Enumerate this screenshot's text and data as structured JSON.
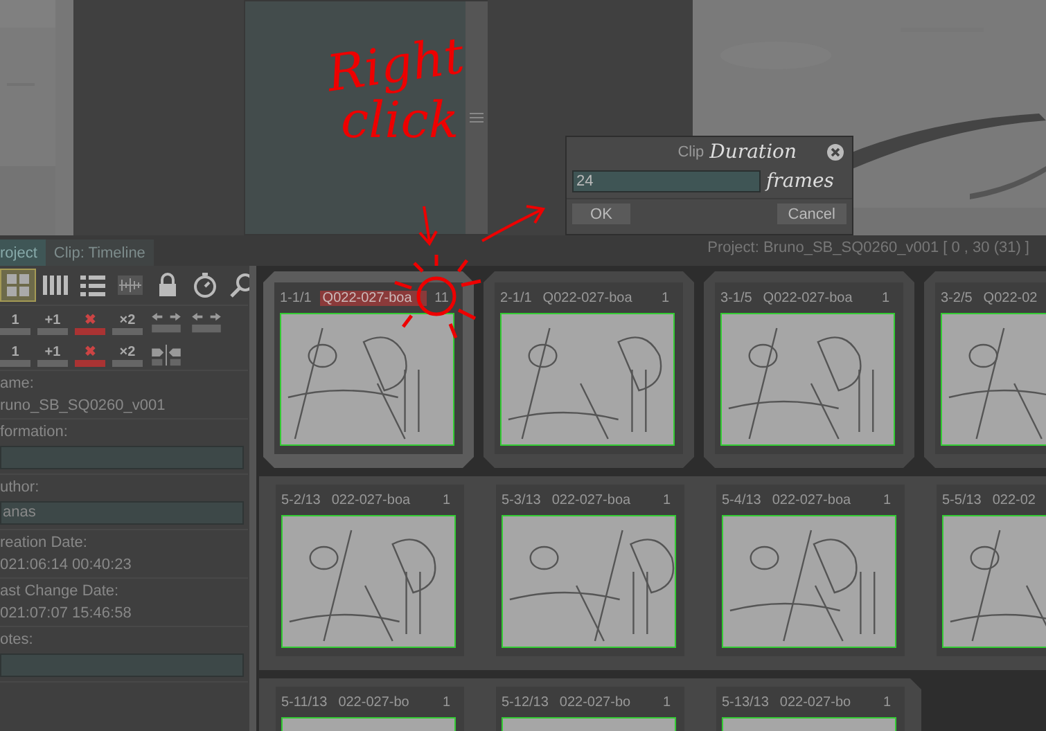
{
  "annotation": {
    "lines": [
      "Right",
      "click"
    ]
  },
  "dialog": {
    "title": "Clip",
    "title_note": "Duration",
    "value": "24",
    "unit": "frames",
    "buttons": [
      "OK",
      "Cancel"
    ]
  },
  "tabs": [
    {
      "label": "roject",
      "selected": true
    },
    {
      "label": "Clip: Timeline",
      "selected": false
    }
  ],
  "status": "Project: Bruno_SB_SQ0260_v001 [ 0 , 30  (31) ]",
  "toolbar": [
    {
      "kind": "grid",
      "selected": true
    },
    {
      "kind": "columns",
      "selected": false
    },
    {
      "kind": "list",
      "selected": false
    },
    {
      "kind": "audio",
      "selected": false
    },
    {
      "kind": "lock",
      "selected": false
    },
    {
      "kind": "stopwatch",
      "selected": false
    },
    {
      "kind": "search",
      "selected": false
    }
  ],
  "clip_rows": [
    [
      {
        "kind": "text",
        "label": "1"
      },
      {
        "kind": "text",
        "label": "+1"
      },
      {
        "kind": "delete",
        "label": "✖"
      },
      {
        "kind": "text",
        "label": "×2"
      },
      {
        "kind": "arrows"
      },
      {
        "kind": "arrows"
      }
    ],
    [
      {
        "kind": "text",
        "label": "1"
      },
      {
        "kind": "text",
        "label": "+1"
      },
      {
        "kind": "delete",
        "label": "✖"
      },
      {
        "kind": "text",
        "label": "×2"
      },
      {
        "kind": "split"
      }
    ]
  ],
  "properties": [
    {
      "kind": "text",
      "label": "ame:",
      "value": "runo_SB_SQ0260_v001"
    },
    {
      "kind": "field",
      "label": "formation:"
    },
    {
      "kind": "field",
      "label": "uthor:",
      "value": "anas"
    },
    {
      "kind": "text",
      "label": "reation Date:",
      "value": "021:06:14 00:40:23"
    },
    {
      "kind": "text",
      "label": "ast Change Date:",
      "value": "021:07:07 15:46:58"
    },
    {
      "kind": "field",
      "label": "otes:"
    }
  ],
  "rows": [
    {
      "kind": "separate",
      "groups": [
        {
          "selected": true,
          "cards": [
            {
              "number": "1-1/1",
              "name": "Q022-027-boa",
              "count": "11",
              "name_selected": true
            }
          ]
        },
        {
          "selected": false,
          "cards": [
            {
              "number": "2-1/1",
              "name": "Q022-027-boa",
              "count": "1",
              "name_selected": false
            }
          ]
        },
        {
          "selected": false,
          "cards": [
            {
              "number": "3-1/5",
              "name": "Q022-027-boa",
              "count": "1",
              "name_selected": false
            }
          ]
        },
        {
          "selected": false,
          "cards": [
            {
              "number": "3-2/5",
              "name": "Q022-02",
              "name_selected": false
            }
          ]
        }
      ]
    },
    {
      "kind": "band",
      "groups": [
        {
          "selected": false,
          "cards": [
            {
              "number": "5-2/13",
              "name": "022-027-boa",
              "count": "1",
              "name_selected": false
            },
            {
              "number": "5-3/13",
              "name": "022-027-boa",
              "count": "1",
              "name_selected": false
            },
            {
              "number": "5-4/13",
              "name": "022-027-boa",
              "count": "1",
              "name_selected": false
            },
            {
              "number": "5-5/13",
              "name": "022-02",
              "name_selected": false
            }
          ]
        }
      ]
    },
    {
      "kind": "band",
      "groups": [
        {
          "selected": false,
          "cards": [
            {
              "number": "5-11/13",
              "name": "022-027-bo",
              "count": "1",
              "name_selected": false
            },
            {
              "number": "5-12/13",
              "name": "022-027-bo",
              "count": "1",
              "name_selected": false
            },
            {
              "number": "5-13/13",
              "name": "022-027-bo",
              "count": "1",
              "name_selected": false
            }
          ]
        }
      ]
    }
  ]
}
